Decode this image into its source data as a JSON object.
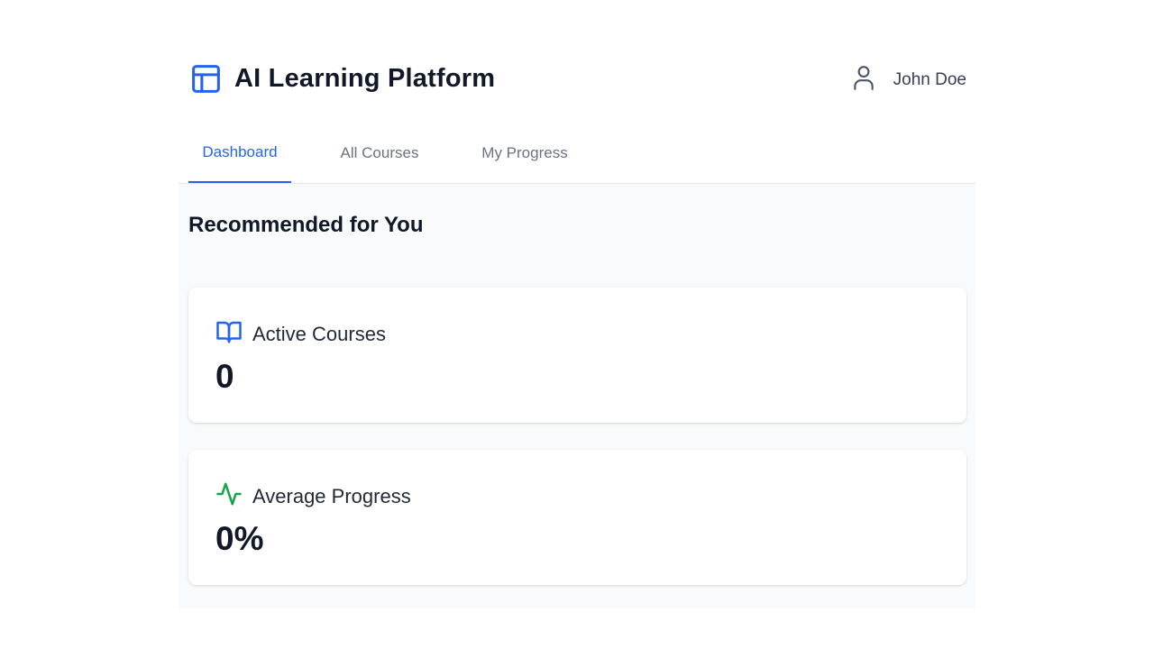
{
  "app": {
    "title": "AI Learning Platform",
    "logo_icon": "layout-icon",
    "accent_color": "#2563eb"
  },
  "user": {
    "name": "John Doe",
    "icon": "user-icon"
  },
  "tabs": [
    {
      "label": "Dashboard",
      "active": true
    },
    {
      "label": "All Courses",
      "active": false
    },
    {
      "label": "My Progress",
      "active": false
    }
  ],
  "main": {
    "section_title": "Recommended for You",
    "stats": [
      {
        "label": "Active Courses",
        "value": "0",
        "icon": "book-open-icon",
        "icon_color": "#2563eb"
      },
      {
        "label": "Average Progress",
        "value": "0%",
        "icon": "activity-icon",
        "icon_color": "#16a34a"
      }
    ]
  }
}
